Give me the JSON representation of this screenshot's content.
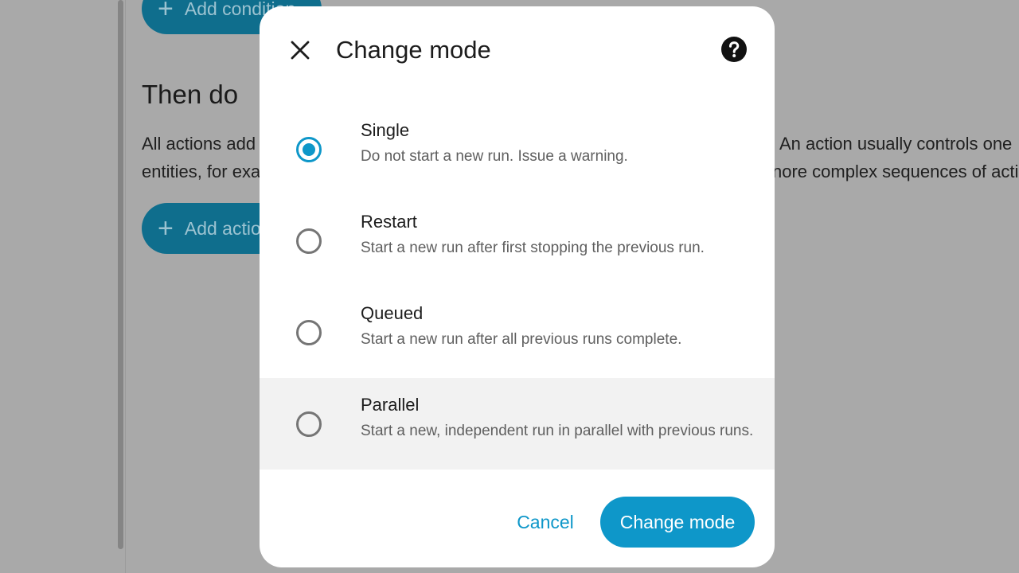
{
  "background": {
    "add_condition_label": "Add condition",
    "add_condition_icon": "plus-icon",
    "section_title": "Then do",
    "description_left_1": "All actions add",
    "description_left_2": "entities, for exa",
    "description_right_1": "An action usually controls one",
    "description_right_2": "nore complex sequences of acti",
    "add_action_label": "Add actio",
    "add_action_icon": "plus-icon"
  },
  "dialog": {
    "title": "Change mode",
    "close_icon": "close-icon",
    "help_icon": "help-circle-icon",
    "selected": "Single",
    "hovered": "Parallel",
    "options": [
      {
        "label": "Single",
        "description": "Do not start a new run. Issue a warning."
      },
      {
        "label": "Restart",
        "description": "Start a new run after first stopping the previous run."
      },
      {
        "label": "Queued",
        "description": "Start a new run after all previous runs complete."
      },
      {
        "label": "Parallel",
        "description": "Start a new, independent run in parallel with previous runs."
      }
    ],
    "cancel_label": "Cancel",
    "confirm_label": "Change mode"
  },
  "colors": {
    "accent": "#0e97c9",
    "overlay_background": "#a9a9a9",
    "dialog_background": "#ffffff",
    "hover_row": "#f2f2f2"
  }
}
